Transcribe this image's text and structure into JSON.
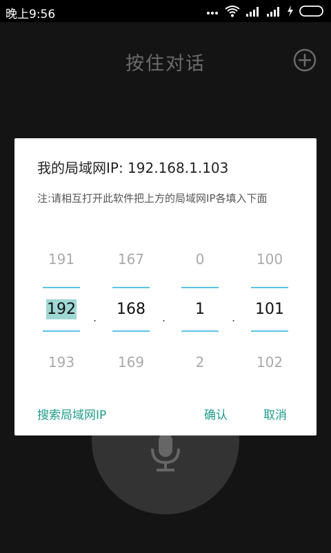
{
  "status_bar": {
    "time": "晚上9:56",
    "icons": [
      "more-dots-icon",
      "wifi-icon",
      "signal-icon",
      "signal-icon",
      "charging-icon",
      "battery-icon"
    ]
  },
  "app": {
    "title": "按住对话",
    "add_icon": "add-circle-icon",
    "mic_icon": "microphone-icon"
  },
  "dialog": {
    "title": "我的局域网IP: 192.168.1.103",
    "note": "注:请相互打开此软件把上方的局域网IP各填入下面",
    "ip_pickers": [
      {
        "prev": "191",
        "current": "192",
        "next": "193"
      },
      {
        "prev": "167",
        "current": "168",
        "next": "169"
      },
      {
        "prev": "0",
        "current": "1",
        "next": "2"
      },
      {
        "prev": "100",
        "current": "101",
        "next": "102"
      }
    ],
    "separator": ".",
    "buttons": {
      "search": "搜索局域网IP",
      "confirm": "确认",
      "cancel": "取消"
    }
  },
  "colors": {
    "accent": "#1f9b8a",
    "picker_line": "#5bc3e2",
    "selection": "#9fd7d4"
  }
}
